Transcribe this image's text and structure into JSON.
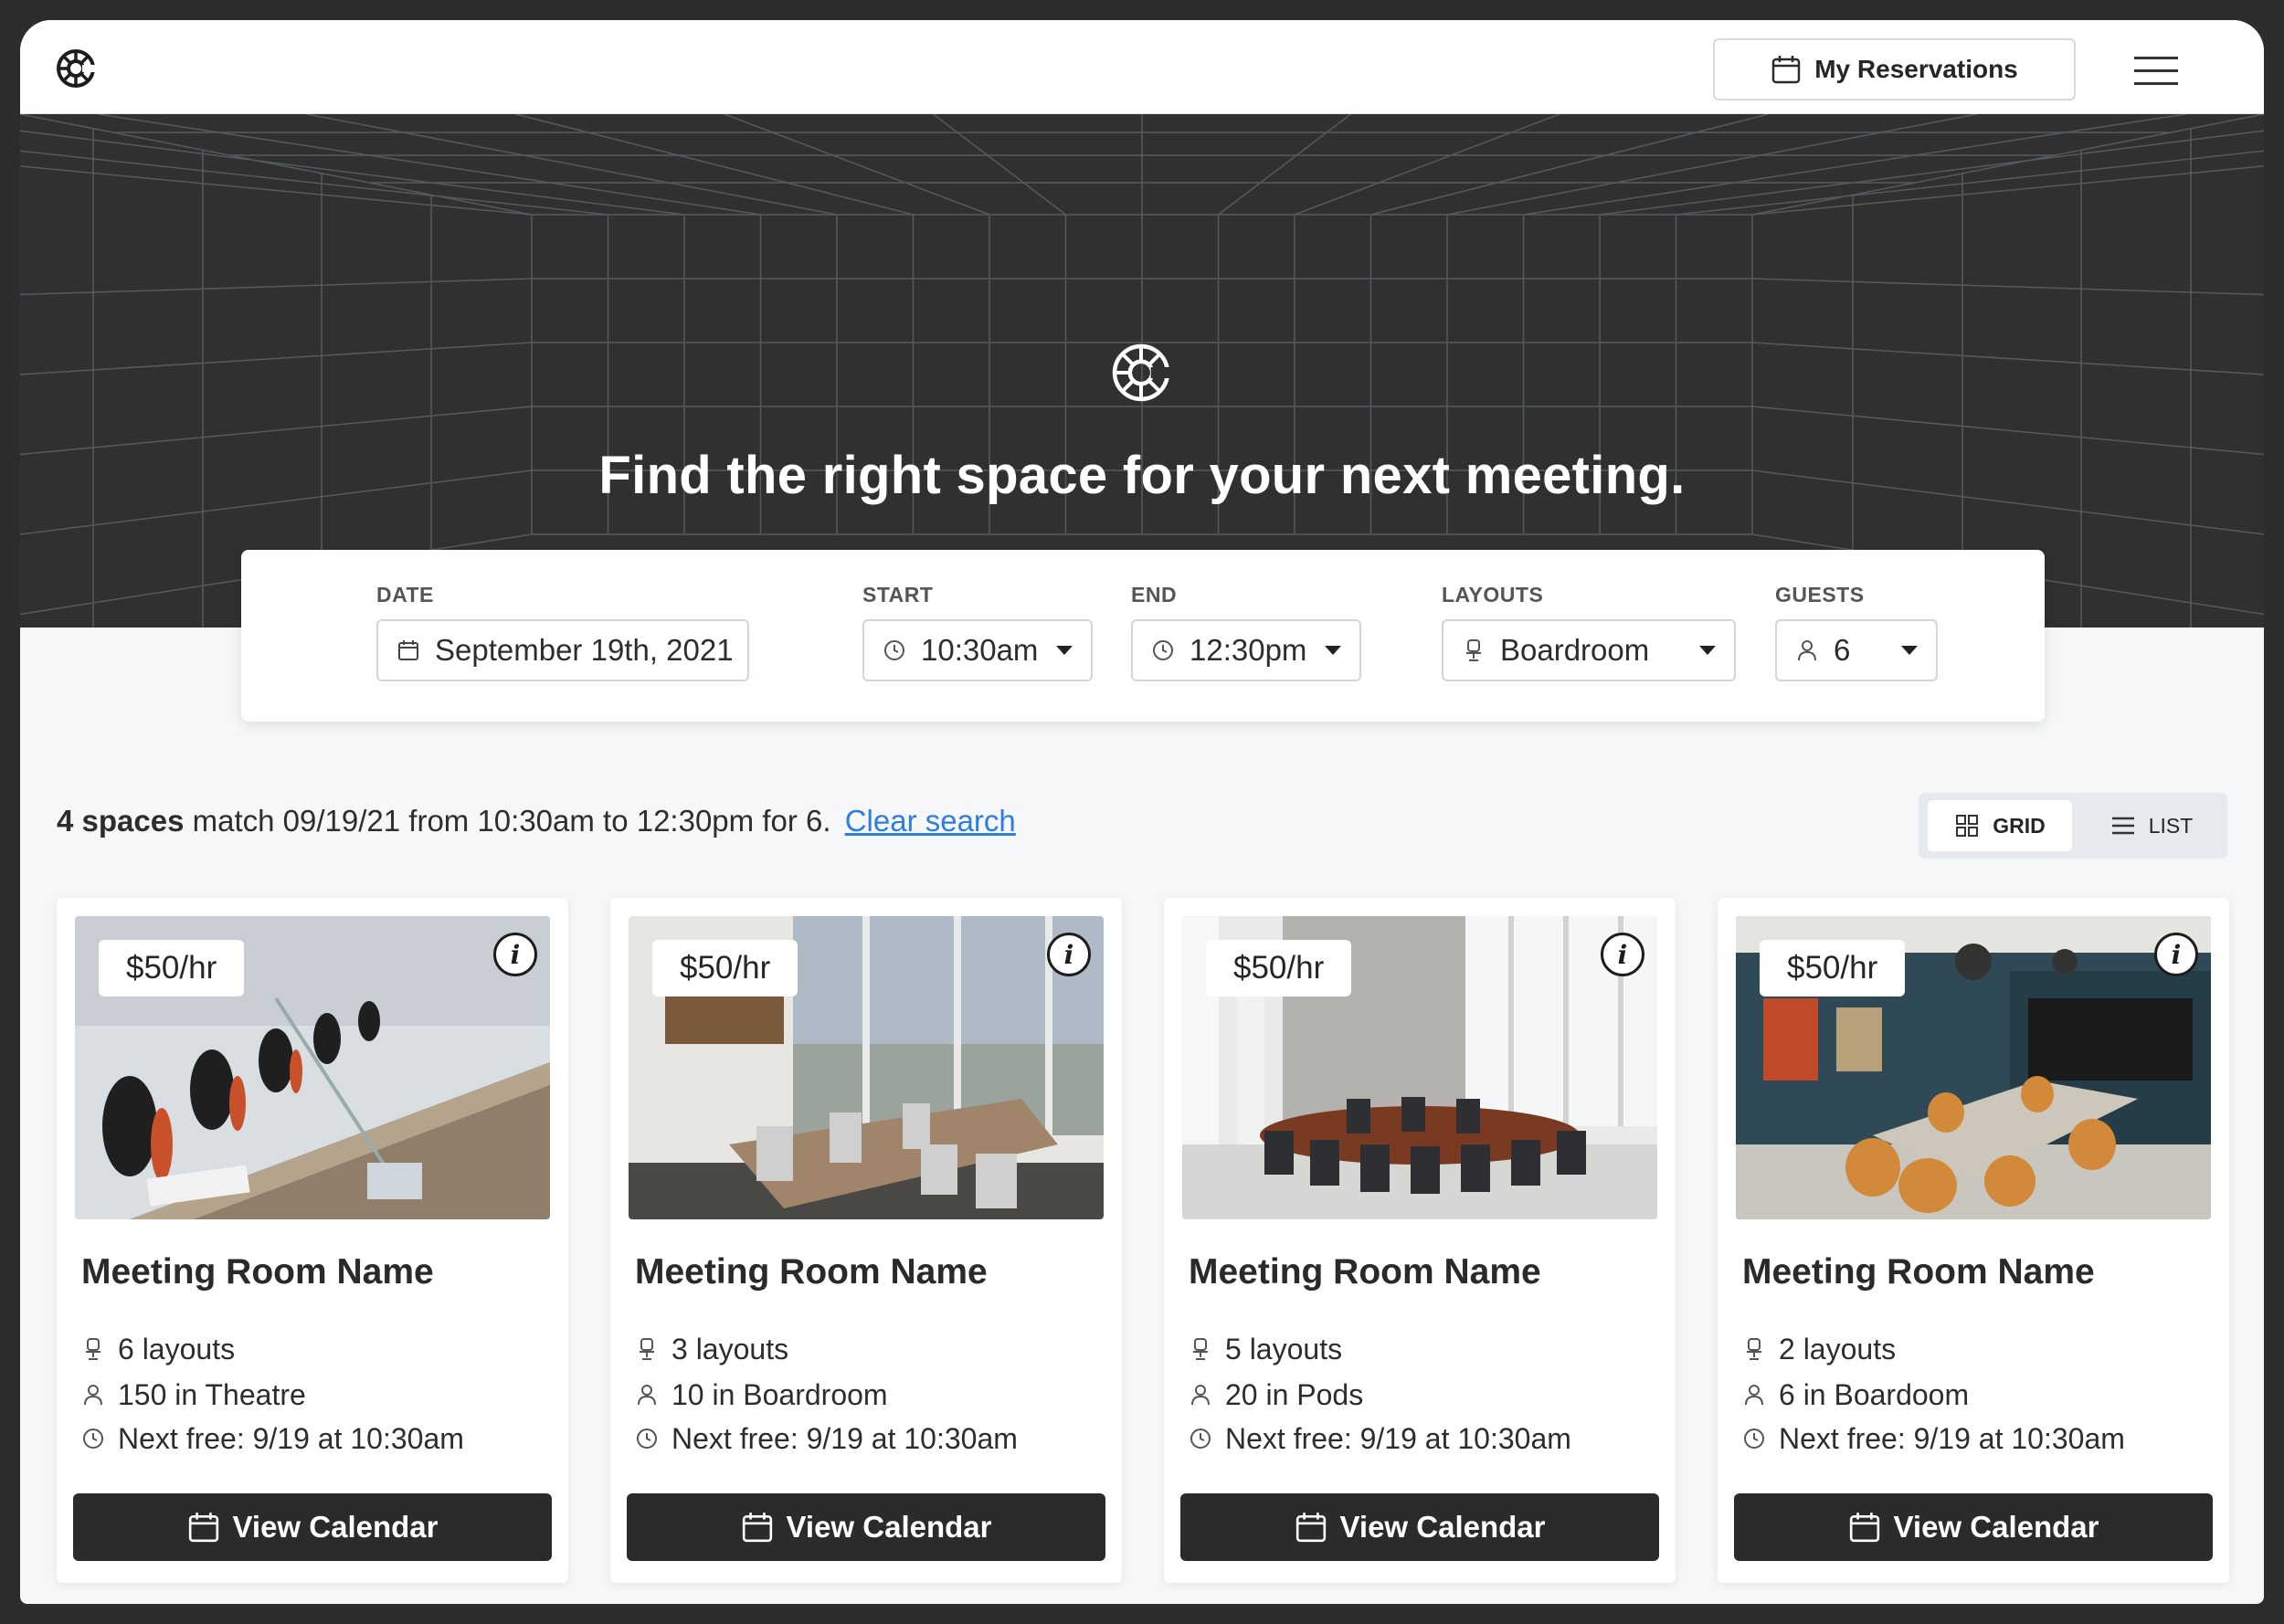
{
  "header": {
    "reservations_label": "My Reservations"
  },
  "hero": {
    "title": "Find the right space for your next meeting."
  },
  "search": {
    "date_label": "DATE",
    "date_value": "September 19th, 2021",
    "start_label": "START",
    "start_value": "10:30am",
    "end_label": "END",
    "end_value": "12:30pm",
    "layouts_label": "LAYOUTS",
    "layouts_value": "Boardroom",
    "guests_label": "GUESTS",
    "guests_value": "6"
  },
  "results": {
    "count_text": "4 spaces",
    "match_text": "match 09/19/21 from 10:30am to 12:30pm for 6.",
    "clear_label": "Clear search",
    "view_grid_label": "GRID",
    "view_list_label": "LIST",
    "active_view": "grid"
  },
  "cards": [
    {
      "price": "$50/hr",
      "name": "Meeting Room Name",
      "layouts": "6 layouts",
      "capacity": "150 in Theatre",
      "next_free": "Next free: 9/19 at 10:30am",
      "button": "View Calendar"
    },
    {
      "price": "$50/hr",
      "name": "Meeting Room Name",
      "layouts": "3 layouts",
      "capacity": "10 in Boardroom",
      "next_free": "Next free: 9/19 at 10:30am",
      "button": "View Calendar"
    },
    {
      "price": "$50/hr",
      "name": "Meeting Room Name",
      "layouts": "5 layouts",
      "capacity": "20 in Pods",
      "next_free": "Next free: 9/19 at 10:30am",
      "button": "View Calendar"
    },
    {
      "price": "$50/hr",
      "name": "Meeting Room Name",
      "layouts": "2 layouts",
      "capacity": "6 in Boardoom",
      "next_free": "Next free: 9/19 at 10:30am",
      "button": "View Calendar"
    }
  ],
  "icons": {
    "logo": "brand-logo-icon",
    "calendar": "calendar-icon",
    "menu": "hamburger-menu-icon",
    "clock": "clock-icon",
    "chair": "chair-icon",
    "person": "person-icon",
    "info": "info-icon",
    "grid": "grid-icon",
    "list": "list-icon"
  },
  "colors": {
    "hero_bg": "#303030",
    "button_dark": "#2b2b2b",
    "link_blue": "#2d7ee0",
    "page_bg": "#f6f7f9"
  }
}
